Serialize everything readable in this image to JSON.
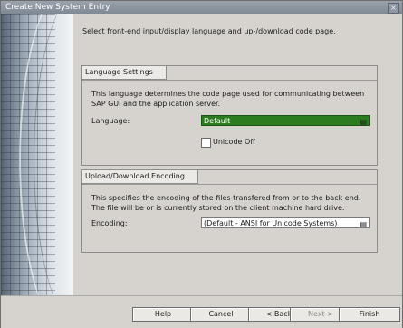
{
  "window": {
    "title": "Create New System Entry",
    "close_glyph": "×"
  },
  "intro": "Select front-end input/display language and up-/download code page.",
  "language_group": {
    "title": "Language Settings",
    "description": "This language determines the code page used for communicating between SAP GUI and the application server.",
    "label": "Language:",
    "value": "Default",
    "checkbox_label": "Unicode Off",
    "checkbox_checked": false
  },
  "encoding_group": {
    "title": "Upload/Download Encoding",
    "description": "This specifies the encoding of the files transfered from or to the back end. The file will be or is currently stored on the client machine hard drive.",
    "label": "Encoding:",
    "value": "(Default - ANSI for Unicode Systems)"
  },
  "buttons": {
    "help": "Help",
    "cancel": "Cancel",
    "back": "< Back",
    "next": "Next >",
    "finish": "Finish"
  },
  "icons": {
    "picker": "list-picker-icon",
    "close": "close-icon"
  },
  "colors": {
    "selection_green": "#2b7b1f",
    "titlebar": "#8a939d"
  }
}
